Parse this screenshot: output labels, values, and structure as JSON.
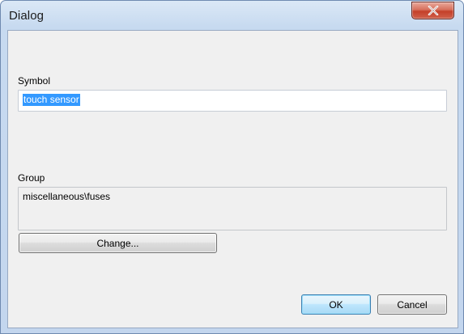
{
  "window": {
    "title": "Dialog",
    "close_icon": "close-x-icon"
  },
  "form": {
    "symbol_label": "Symbol",
    "symbol_value": "touch sensor",
    "group_label": "Group",
    "group_value": "miscellaneous\\fuses"
  },
  "buttons": {
    "change_label": "Change...",
    "ok_label": "OK",
    "cancel_label": "Cancel"
  },
  "colors": {
    "selection": "#3399ff",
    "close_button": "#c4402a",
    "default_button_border": "#3c7fb1"
  }
}
